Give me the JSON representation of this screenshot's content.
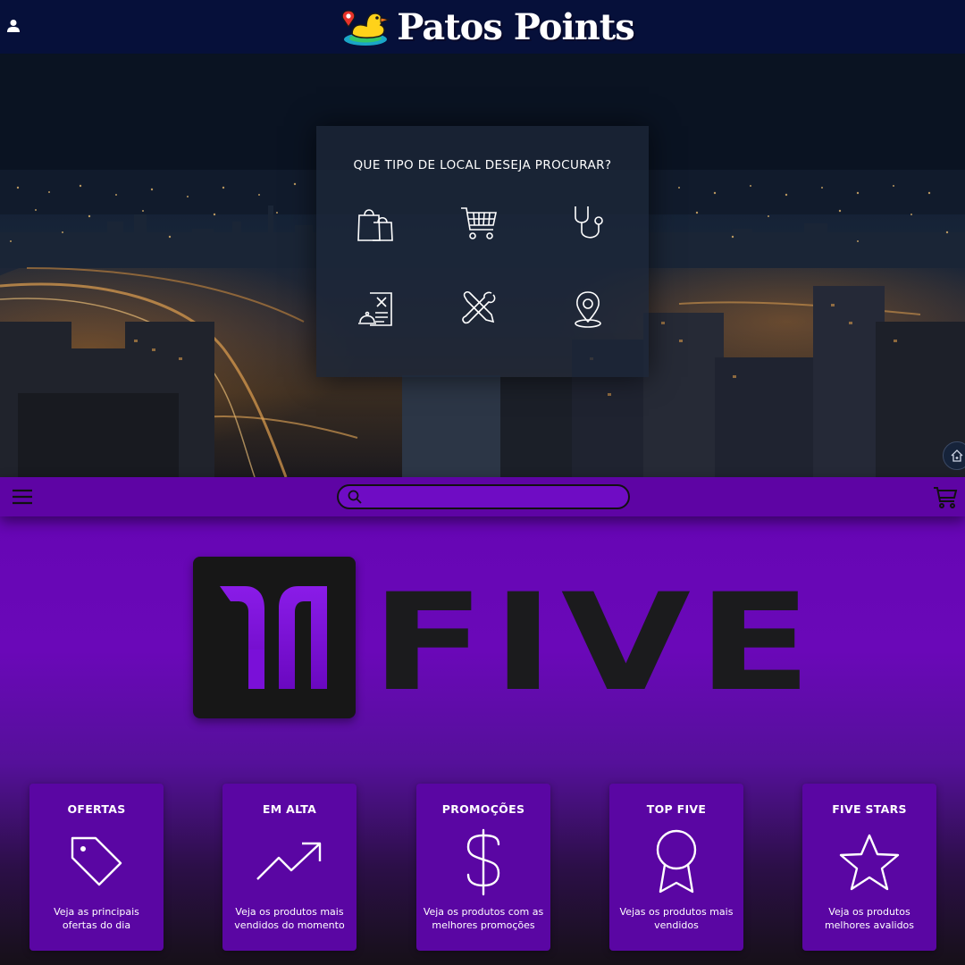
{
  "header": {
    "brand": "Patos Points",
    "user_icon": "user-icon"
  },
  "hero": {
    "card_title": "QUE TIPO DE LOCAL DESEJA PROCURAR?",
    "categories": [
      {
        "icon": "shopping-bags-icon"
      },
      {
        "icon": "shopping-cart-icon"
      },
      {
        "icon": "stethoscope-icon"
      },
      {
        "icon": "restaurant-menu-icon"
      },
      {
        "icon": "tools-icon"
      },
      {
        "icon": "location-pin-icon"
      }
    ],
    "home_icon": "home-icon"
  },
  "toolbar": {
    "menu_icon": "hamburger-menu-icon",
    "search_value": "",
    "cart_icon": "cart-icon"
  },
  "store": {
    "logo_word": "FIVE",
    "colors": {
      "accent": "#6a08b8",
      "card": "#5a06a3",
      "logo": "#171717"
    },
    "cards": [
      {
        "title": "OFERTAS",
        "icon": "price-tag-icon",
        "desc": "Veja as principais ofertas do dia"
      },
      {
        "title": "EM ALTA",
        "icon": "trending-up-icon",
        "desc": "Veja os produtos mais vendidos do momento"
      },
      {
        "title": "PROMOÇÕES",
        "icon": "dollar-sign-icon",
        "desc": "Veja os produtos com as melhores promoções"
      },
      {
        "title": "TOP FIVE",
        "icon": "award-ribbon-icon",
        "desc": "Vejas os produtos mais vendidos"
      },
      {
        "title": "FIVE STARS",
        "icon": "star-icon",
        "desc": "Veja os produtos melhores avalidos"
      }
    ]
  }
}
